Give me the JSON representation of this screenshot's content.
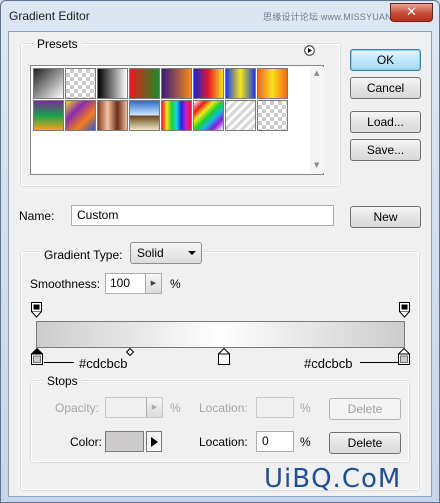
{
  "window": {
    "title": "Gradient Editor",
    "watermark_top": "思缘设计论坛 www.MISSYUAN.COM",
    "close_glyph": "✕"
  },
  "presets": {
    "label": "Presets",
    "menu_icon": "play-circle-icon",
    "swatches": [
      {
        "name": "foreground-to-background",
        "css": "linear-gradient(135deg,#222 0%,#fff 100%)"
      },
      {
        "name": "foreground-to-transparent",
        "css": "checker"
      },
      {
        "name": "black-white",
        "css": "linear-gradient(to right,#000,#fff)"
      },
      {
        "name": "red-green",
        "css": "linear-gradient(to right,#e81c1c,#1e8c28)"
      },
      {
        "name": "violet-orange",
        "css": "linear-gradient(to right,#3a1a7a,#f38a1c)"
      },
      {
        "name": "blue-red-yellow",
        "css": "linear-gradient(to right,#1128c8,#e8162b,#f8e41a)"
      },
      {
        "name": "blue-yellow-blue",
        "css": "linear-gradient(to right,#1c3ae0,#f7e81a,#1c3ae0)"
      },
      {
        "name": "orange-yellow-orange",
        "css": "linear-gradient(to right,#f3671a,#fbe21c,#f3671a)"
      },
      {
        "name": "violet-green-orange",
        "css": "linear-gradient(to bottom,#7b2a9a,#17a24a,#f9a21a)"
      },
      {
        "name": "yellow-violet-orange-blue",
        "css": "linear-gradient(135deg,#f6d21a,#8a2ab0,#f57c1a,#2a58d8)"
      },
      {
        "name": "copper",
        "css": "linear-gradient(to right,#8a3e1c,#f4c4a4,#6a2e14,#f2bda0)"
      },
      {
        "name": "chrome",
        "css": "linear-gradient(to bottom,#2a6ac8 0%,#cde6ff 48%,#6a4a20 52%,#f2e6c2 100%)"
      },
      {
        "name": "spectrum",
        "css": "linear-gradient(to right,#f2161a,#f7e81a,#1ad42a,#16d6e8,#1a2ad6,#d61ad2,#f2161a)"
      },
      {
        "name": "transparent-rainbow",
        "css": "linear-gradient(135deg,#fff 0%,#f2161a 20%,#f7e81a 35%,#1ad42a 50%,#16b6e8 65%,#8a1ad6 80%,#fff 100%)"
      },
      {
        "name": "transparent-stripes",
        "css": "repeating-linear-gradient(135deg,#d8d8d8 0 3px,#fff 3px 6px)"
      },
      {
        "name": "transparent-rainbow-2",
        "css": "checker"
      }
    ]
  },
  "buttons": {
    "ok": "OK",
    "cancel": "Cancel",
    "load": "Load...",
    "save": "Save...",
    "new": "New",
    "delete": "Delete"
  },
  "name_field": {
    "label": "Name:",
    "value": "Custom"
  },
  "gradient_type": {
    "label": "Gradient Type:",
    "value": "Solid"
  },
  "smoothness": {
    "label": "Smoothness:",
    "value": "100",
    "unit": "%"
  },
  "gradient": {
    "left_color": "#cdcbcb",
    "mid_color": "#ffffff",
    "right_color": "#cdcbcb",
    "left_label": "#cdcbcb",
    "right_label": "#cdcbcb"
  },
  "stops": {
    "label": "Stops",
    "opacity_label": "Opacity:",
    "opacity_unit": "%",
    "opacity_location_label": "Location:",
    "opacity_location_unit": "%",
    "color_label": "Color:",
    "color_value": "#cdcbcb",
    "color_location_label": "Location:",
    "color_location_value": "0",
    "color_location_unit": "%"
  },
  "watermark_bottom": "UiBQ.CoM"
}
